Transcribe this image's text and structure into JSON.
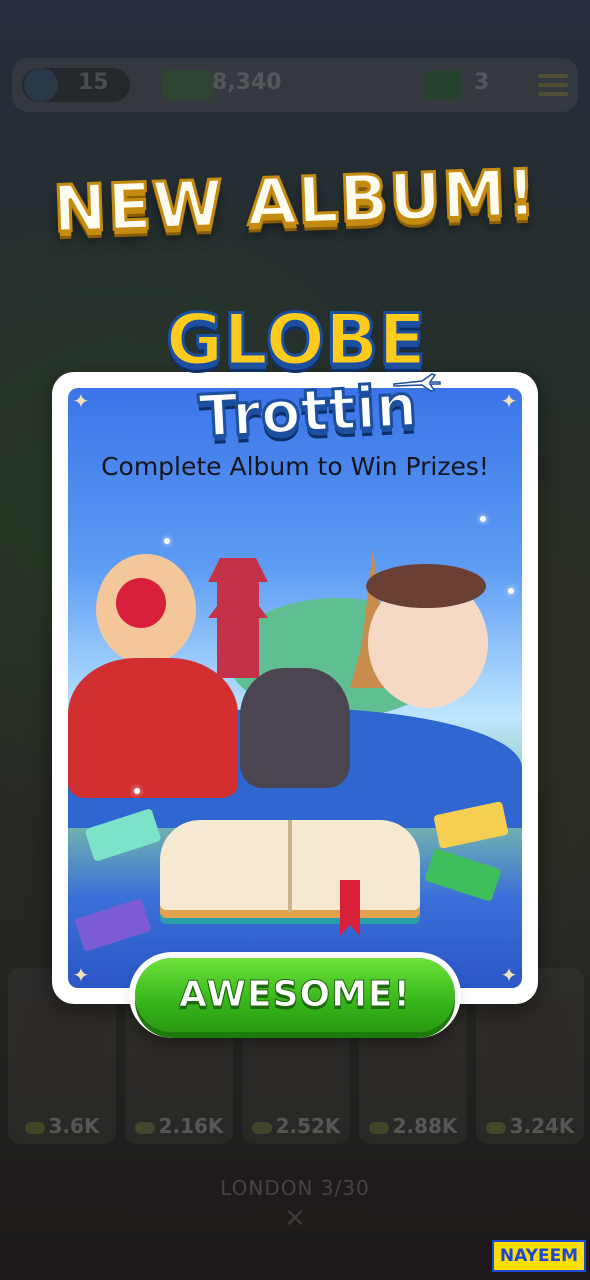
{
  "top_bar": {
    "level": "15",
    "cash": "8,340",
    "houses": "3"
  },
  "headline": "NEW ALBUM!",
  "album": {
    "logo_line1": "GLOBE",
    "logo_line2": "Trottin",
    "subtitle": "Complete Album to Win Prizes!"
  },
  "button": {
    "label": "AWESOME!"
  },
  "properties": [
    {
      "price": "3.6K"
    },
    {
      "price": "2.16K"
    },
    {
      "price": "2.52K"
    },
    {
      "price": "2.88K"
    },
    {
      "price": "3.24K"
    }
  ],
  "footer": {
    "title": "LONDON 3/30",
    "close_icon": "close-icon"
  },
  "watermark": "NAYEEM",
  "colors": {
    "headline_fill": "#fffdf0",
    "headline_outline": "#c58a10",
    "logo_yellow": "#ffcc1e",
    "logo_blue": "#1c4f9e",
    "button_green": "#36b51a",
    "card_bg": "#ffffff",
    "watermark_bg": "#ffde00"
  }
}
